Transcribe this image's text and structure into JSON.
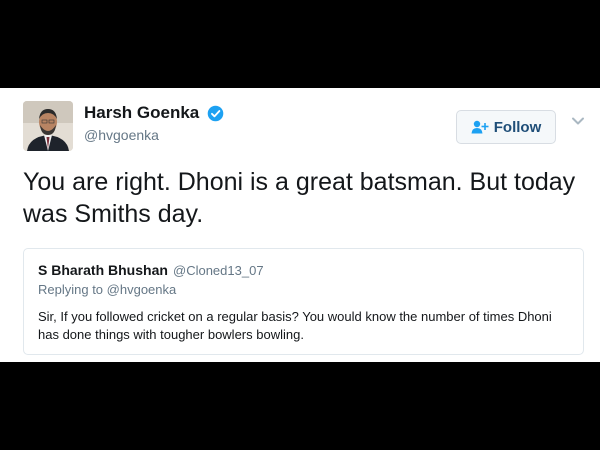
{
  "tweet": {
    "author": {
      "name": "Harsh Goenka",
      "handle": "@hvgoenka",
      "verified": true,
      "avatar": "avatar-photo"
    },
    "follow_button": {
      "label": "Follow",
      "icon": "add-user-icon"
    },
    "more_icon": "chevron-down-icon",
    "text": "You are right. Dhoni is a great batsman. But today was Smiths day."
  },
  "quoted": {
    "name": "S Bharath Bhushan",
    "handle": "@Cloned13_07",
    "replying_prefix": "Replying to",
    "replying_handle": "@hvgoenka",
    "text": "Sir, If you followed cricket on a regular basis? You would know the number of times Dhoni has done things with tougher bowlers bowling."
  },
  "colors": {
    "verified": "#1da1f2",
    "follow_text": "#1f4e78",
    "secondary_text": "#657786",
    "primary_text": "#14171a"
  }
}
